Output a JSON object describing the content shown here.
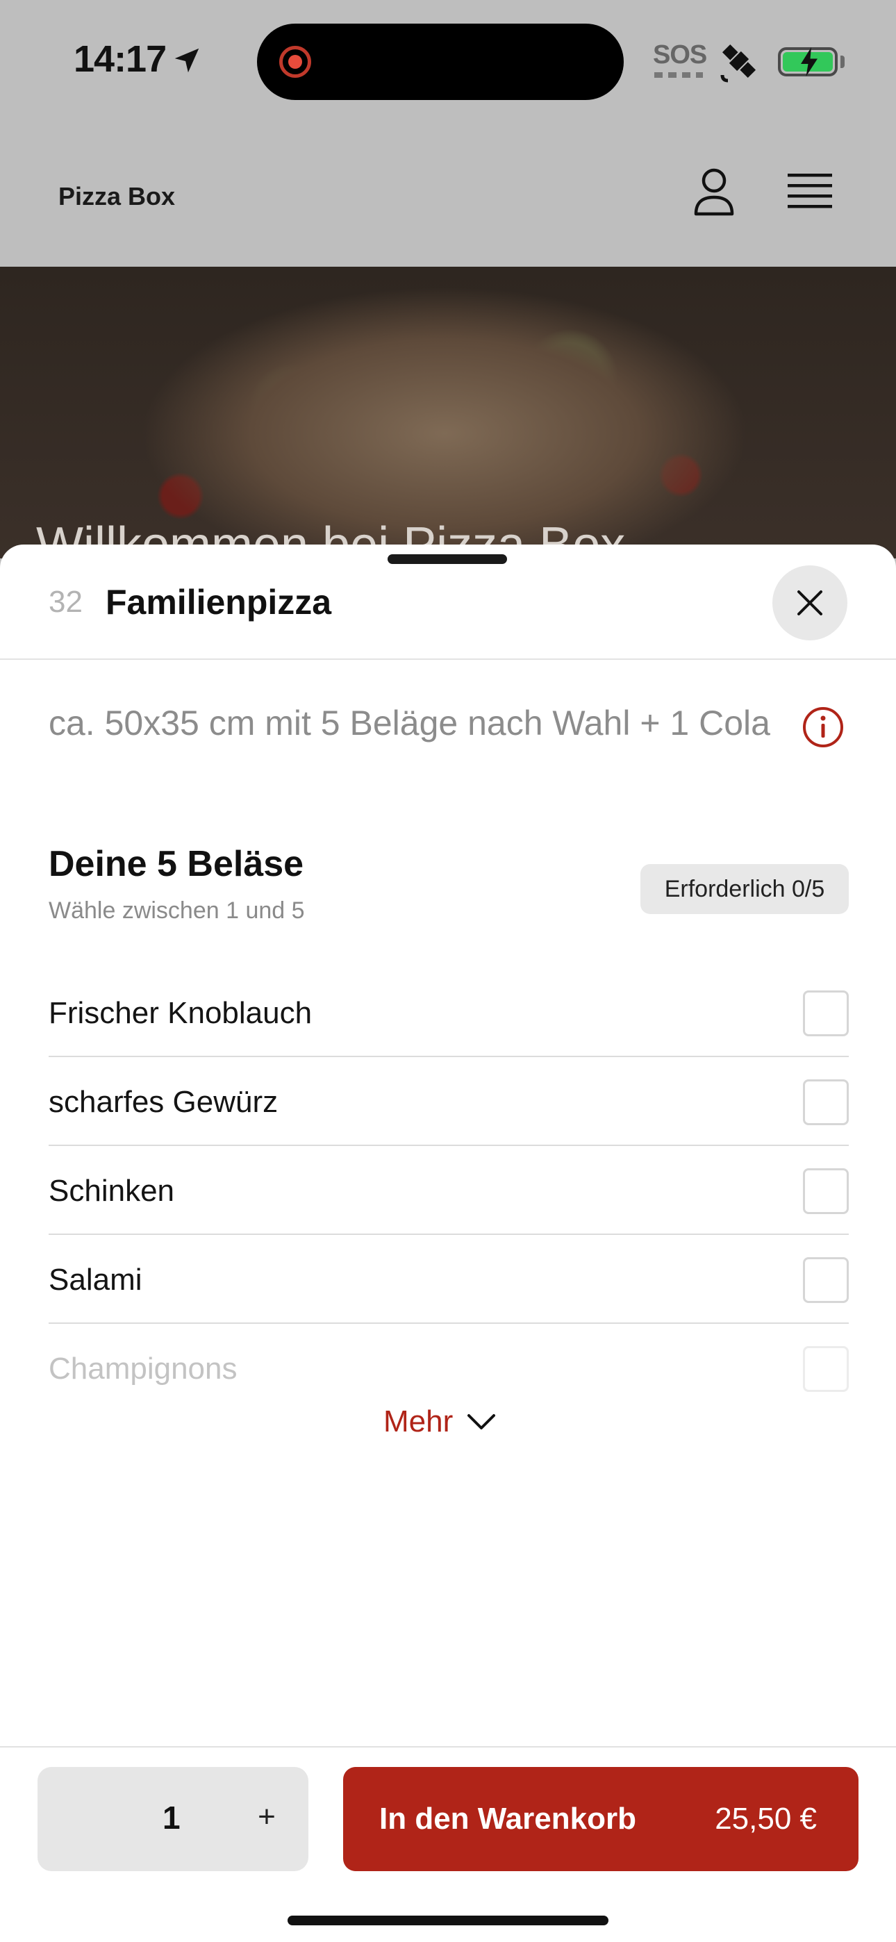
{
  "status_bar": {
    "time": "14:17",
    "sos": "SOS",
    "icons": [
      "location-arrow-icon",
      "screen-recording-icon",
      "satellite-icon",
      "battery-charging-icon"
    ],
    "battery_color": "#32c85a"
  },
  "header": {
    "brand": "Pizza Box",
    "icons": [
      "user-icon",
      "menu-icon"
    ]
  },
  "hero": {
    "title": "Willkommen bei Pizza Box"
  },
  "sheet": {
    "item_number": "32",
    "item_title": "Familienpizza",
    "description": "ca. 50x35 cm mit 5 Beläge nach Wahl + 1 Cola",
    "group": {
      "title": "Deine 5 Beläse",
      "subtitle": "Wähle zwischen 1 und 5",
      "badge": "Erforderlich 0/5"
    },
    "options": [
      {
        "label": "Frischer Knoblauch",
        "checked": false
      },
      {
        "label": "scharfes Gewürz",
        "checked": false
      },
      {
        "label": "Schinken",
        "checked": false
      },
      {
        "label": "Salami",
        "checked": false
      },
      {
        "label": "Champignons",
        "checked": false
      }
    ],
    "more_label": "Mehr"
  },
  "footer": {
    "quantity": "1",
    "plus": "+",
    "cart_label": "In den Warenkorb",
    "cart_price": "25,50 €"
  },
  "colors": {
    "accent": "#b02418",
    "overlay": "#bebebe"
  }
}
